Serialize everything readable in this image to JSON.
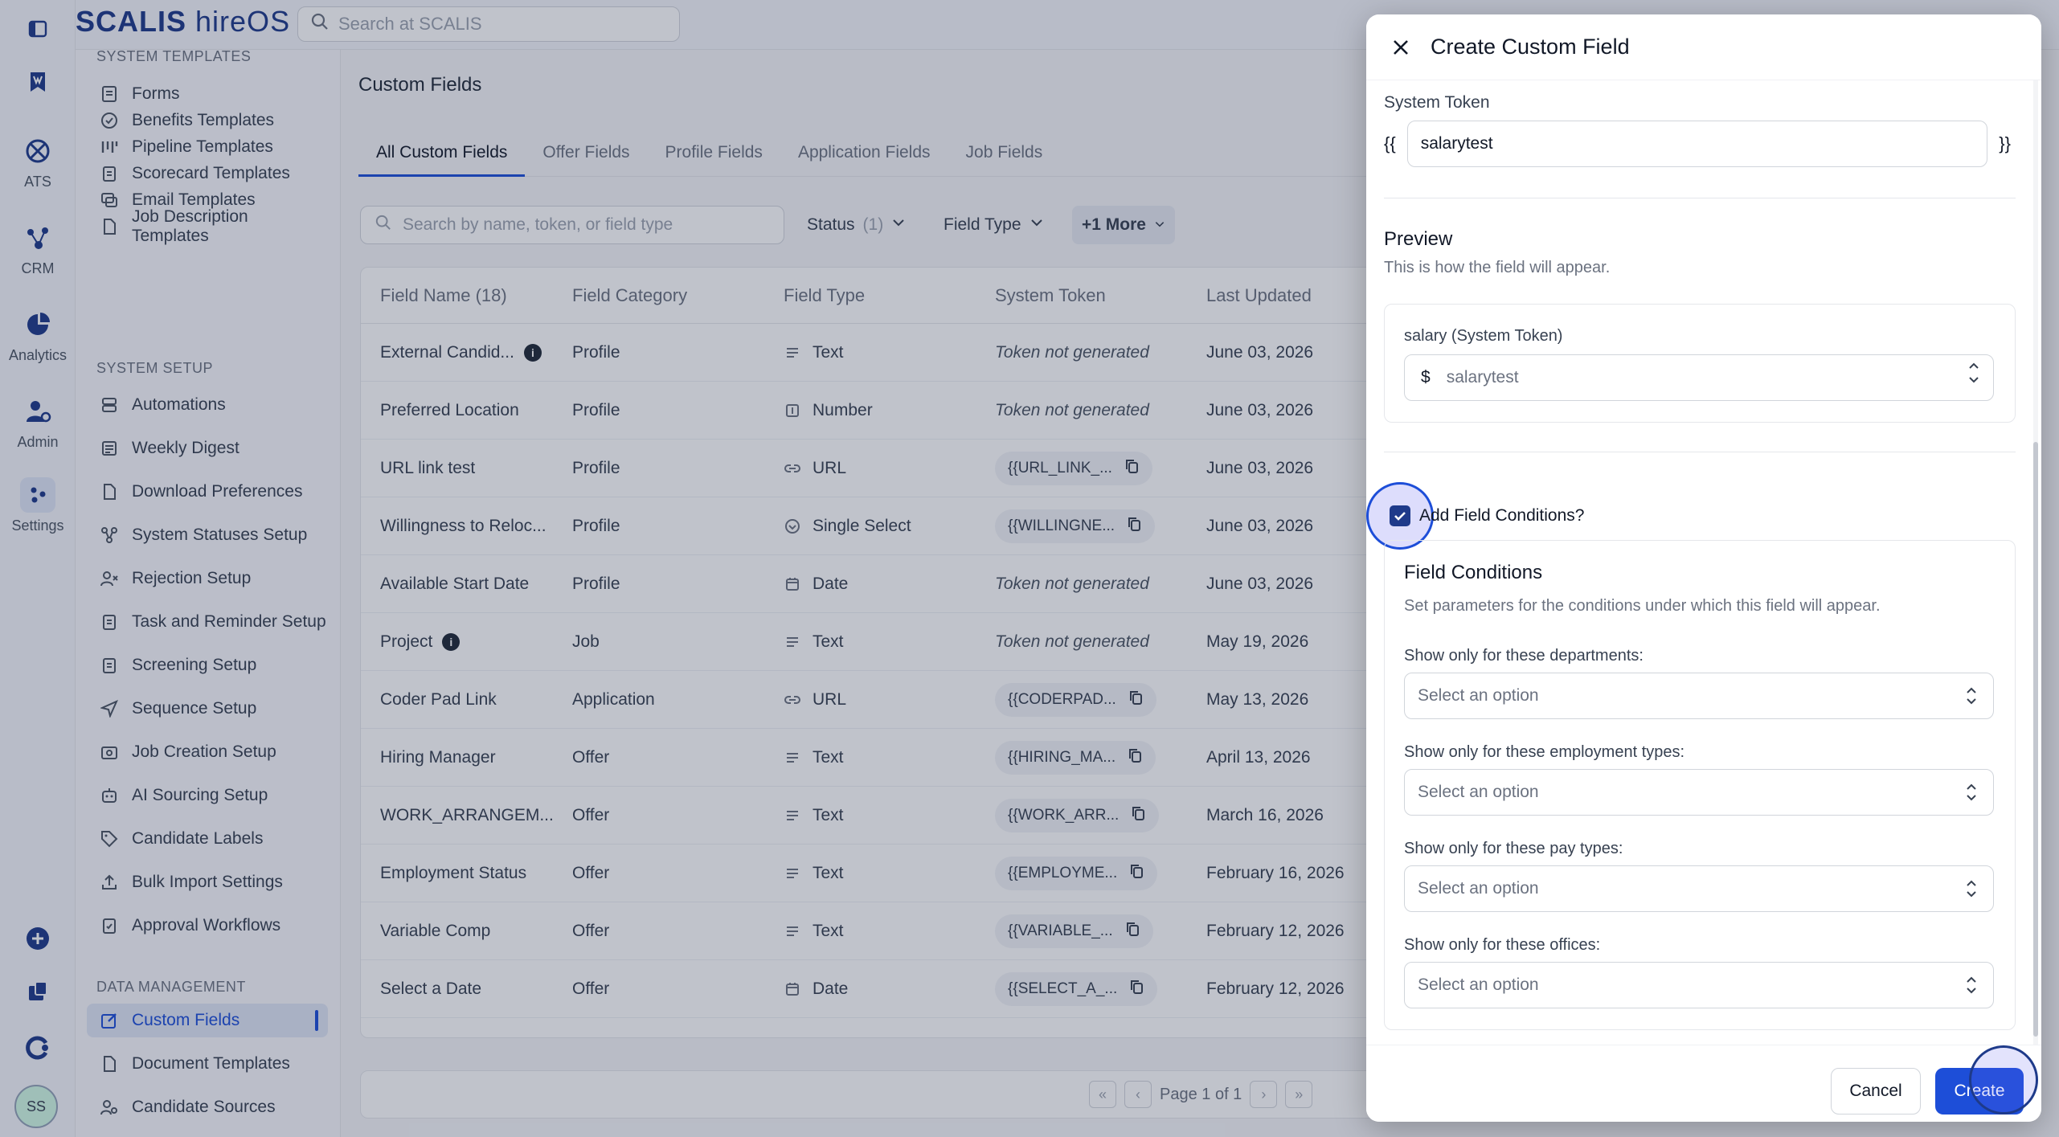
{
  "app": {
    "logo": "SCALIS",
    "logo_suffix": "hireOS",
    "search_placeholder": "Search at SCALIS",
    "avatar": "SS"
  },
  "rail": [
    {
      "name": "ATS",
      "icon": "ats-icon"
    },
    {
      "name": "CRM",
      "icon": "crm-icon"
    },
    {
      "name": "Analytics",
      "icon": "analytics-icon"
    },
    {
      "name": "Admin",
      "icon": "admin-icon"
    },
    {
      "name": "Settings",
      "icon": "settings-icon"
    }
  ],
  "sidebar": {
    "section_templates": "SYSTEM TEMPLATES",
    "templates": [
      "Forms",
      "Benefits Templates",
      "Pipeline Templates",
      "Scorecard Templates",
      "Email Templates",
      "Job Description Templates"
    ],
    "section_setup": "SYSTEM SETUP",
    "setup": [
      "Automations",
      "Weekly Digest",
      "Download Preferences",
      "System Statuses Setup",
      "Rejection Setup",
      "Task and Reminder Setup",
      "Screening Setup",
      "Sequence Setup",
      "Job Creation Setup",
      "AI Sourcing Setup",
      "Candidate Labels",
      "Bulk Import Settings",
      "Approval Workflows"
    ],
    "section_data": "DATA MANAGEMENT",
    "data": [
      "Custom Fields",
      "Document Templates",
      "Candidate Sources"
    ]
  },
  "main": {
    "title": "Custom Fields",
    "tabs": [
      "All Custom Fields",
      "Offer Fields",
      "Profile Fields",
      "Application Fields",
      "Job Fields"
    ],
    "search_placeholder": "Search by name, token, or field type",
    "filters": {
      "status": "Status",
      "status_count": "(1)",
      "field_type": "Field Type",
      "more": "+1 More"
    },
    "columns": [
      "Field Name (18)",
      "Field Category",
      "Field Type",
      "System Token",
      "Last Updated"
    ],
    "rows": [
      {
        "name": "External Candid...",
        "info": true,
        "category": "Profile",
        "type": "Text",
        "type_icon": "text-lines-icon",
        "token": "Token not generated",
        "has_token": false,
        "updated": "June 03, 2026"
      },
      {
        "name": "Preferred Location",
        "info": false,
        "category": "Profile",
        "type": "Number",
        "type_icon": "number-icon",
        "token": "Token not generated",
        "has_token": false,
        "updated": "June 03, 2026"
      },
      {
        "name": "URL link test",
        "info": false,
        "category": "Profile",
        "type": "URL",
        "type_icon": "link-icon",
        "token": "{{URL_LINK_...",
        "has_token": true,
        "updated": "June 03, 2026"
      },
      {
        "name": "Willingness to Reloc...",
        "info": false,
        "category": "Profile",
        "type": "Single Select",
        "type_icon": "single-select-icon",
        "token": "{{WILLINGNE...",
        "has_token": true,
        "updated": "June 03, 2026"
      },
      {
        "name": "Available Start Date",
        "info": false,
        "category": "Profile",
        "type": "Date",
        "type_icon": "calendar-icon",
        "token": "Token not generated",
        "has_token": false,
        "updated": "June 03, 2026"
      },
      {
        "name": "Project",
        "info": true,
        "category": "Job",
        "type": "Text",
        "type_icon": "text-lines-icon",
        "token": "Token not generated",
        "has_token": false,
        "updated": "May 19, 2026"
      },
      {
        "name": "Coder Pad Link",
        "info": false,
        "category": "Application",
        "type": "URL",
        "type_icon": "link-icon",
        "token": "{{CODERPAD...",
        "has_token": true,
        "updated": "May 13, 2026"
      },
      {
        "name": "Hiring Manager",
        "info": false,
        "category": "Offer",
        "type": "Text",
        "type_icon": "text-lines-icon",
        "token": "{{HIRING_MA...",
        "has_token": true,
        "updated": "April 13, 2026"
      },
      {
        "name": "WORK_ARRANGEM...",
        "info": false,
        "category": "Offer",
        "type": "Text",
        "type_icon": "text-lines-icon",
        "token": "{{WORK_ARR...",
        "has_token": true,
        "updated": "March 16, 2026"
      },
      {
        "name": "Employment Status",
        "info": false,
        "category": "Offer",
        "type": "Text",
        "type_icon": "text-lines-icon",
        "token": "{{EMPLOYME...",
        "has_token": true,
        "updated": "February 16, 2026"
      },
      {
        "name": "Variable Comp",
        "info": false,
        "category": "Offer",
        "type": "Text",
        "type_icon": "text-lines-icon",
        "token": "{{VARIABLE_...",
        "has_token": true,
        "updated": "February 12, 2026"
      },
      {
        "name": "Select a Date",
        "info": false,
        "category": "Offer",
        "type": "Date",
        "type_icon": "calendar-icon",
        "token": "{{SELECT_A_...",
        "has_token": true,
        "updated": "February 12, 2026"
      }
    ],
    "pager": "Page 1 of 1"
  },
  "modal": {
    "title": "Create Custom Field",
    "system_token_label": "System Token",
    "token_open": "{{",
    "token_close": "}}",
    "token_value": "salarytest",
    "preview_title": "Preview",
    "preview_sub": "This is how the field will appear.",
    "preview_field_label": "salary (System Token)",
    "preview_prefix": "$",
    "preview_value": "salarytest",
    "conditions_checkbox": "Add Field Conditions?",
    "conditions_checked": true,
    "conditions_title": "Field Conditions",
    "conditions_sub": "Set parameters for the conditions under which this field will appear.",
    "conditions": [
      {
        "label": "Show only for these departments:",
        "placeholder": "Select an option"
      },
      {
        "label": "Show only for these employment types:",
        "placeholder": "Select an option"
      },
      {
        "label": "Show only for these pay types:",
        "placeholder": "Select an option"
      },
      {
        "label": "Show only for these offices:",
        "placeholder": "Select an option"
      }
    ],
    "cancel": "Cancel",
    "create": "Create"
  },
  "colors": {
    "brand": "#1e3a8a",
    "primary_button": "#1d4ed8"
  }
}
